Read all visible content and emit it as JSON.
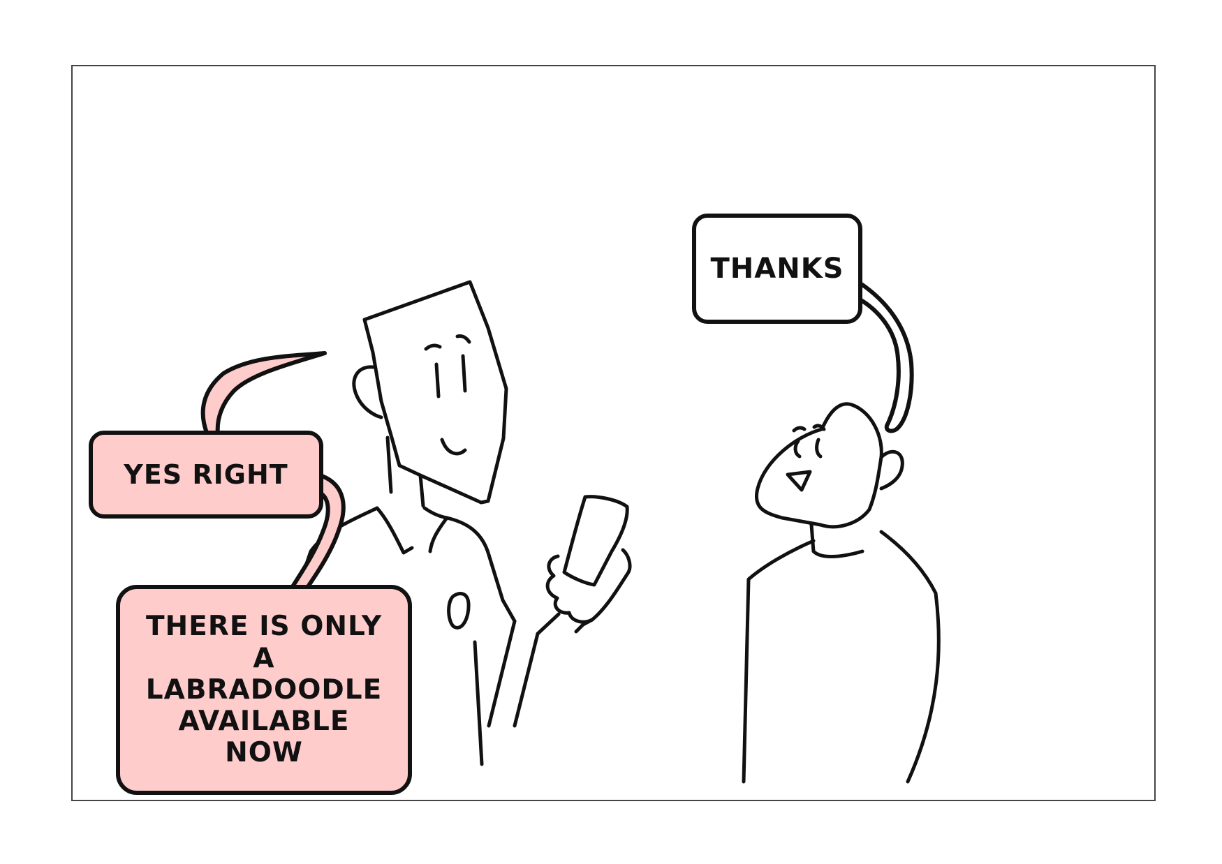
{
  "panel": {
    "bubbles": {
      "yes_right": "YES RIGHT",
      "labradoodle": "THERE IS ONLY\nA\nLABRADOODLE\nAVAILABLE\nNOW",
      "thanks": "THANKS"
    },
    "colors": {
      "pink_bubble": "#ffcccc",
      "white_bubble": "#ffffff",
      "ink": "#111111",
      "frame": "#444444"
    },
    "characters": [
      "shop-clerk-with-phone",
      "customer"
    ]
  }
}
